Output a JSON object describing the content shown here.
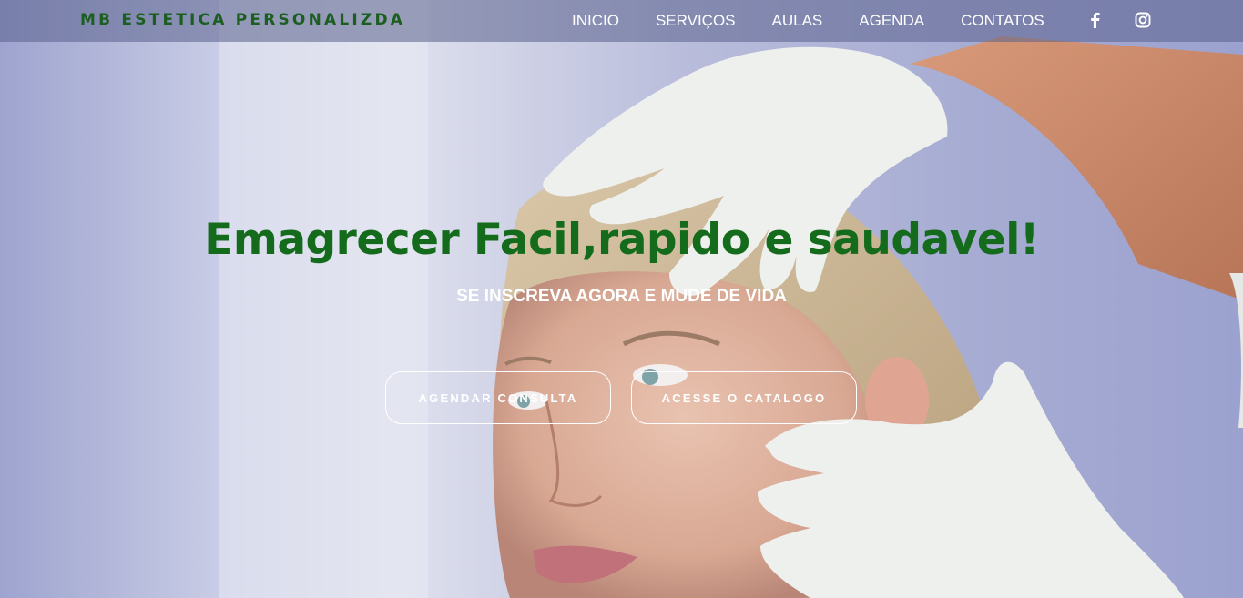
{
  "brand": {
    "name": "MB ESTETICA PERSONALIZDA"
  },
  "nav": {
    "items": [
      {
        "label": "INICIO"
      },
      {
        "label": "SERVIÇOS"
      },
      {
        "label": "AULAS"
      },
      {
        "label": "AGENDA"
      },
      {
        "label": "CONTATOS"
      }
    ],
    "social": [
      {
        "icon": "facebook-icon"
      },
      {
        "icon": "instagram-icon"
      }
    ]
  },
  "hero": {
    "title": "Emagrecer Facil,rapido e saudavel!",
    "subtitle": "SE INSCREVA AGORA E MUDE DE VIDA",
    "buttons": [
      {
        "label": "AGENDAR CONSULTA"
      },
      {
        "label": "ACESSE O CATALOGO"
      }
    ]
  },
  "colors": {
    "brand_green": "#1b5e20",
    "title_green": "#156b1c",
    "navbar_bg": "#5a608c",
    "text_white": "#ffffff"
  }
}
